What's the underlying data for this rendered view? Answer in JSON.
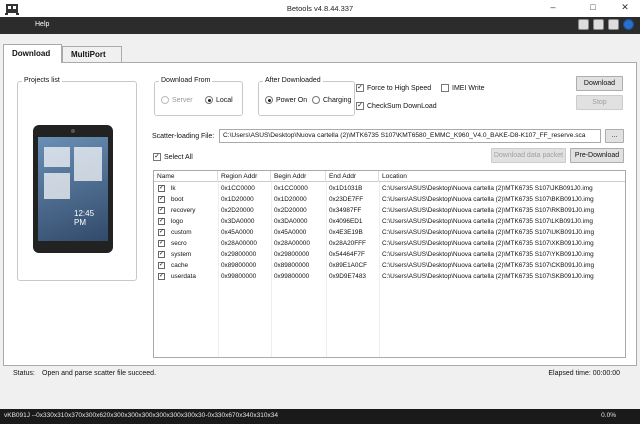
{
  "window": {
    "title": "Betools v4.8.44.337",
    "minimize": "–",
    "maximize": "□",
    "close": "✕"
  },
  "menu": {
    "help": "Help"
  },
  "tabs": [
    {
      "label": "Download"
    },
    {
      "label": "MultiPort"
    }
  ],
  "projects": {
    "label": "Projects list",
    "clock": "12:45 PM"
  },
  "download_from": {
    "label": "Download From",
    "options": [
      "Server",
      "Local"
    ],
    "selected": "Local"
  },
  "after_downloaded": {
    "label": "After Downloaded",
    "options": [
      "Power On",
      "Charging"
    ],
    "selected": "Power On"
  },
  "options": {
    "force_high_speed": {
      "label": "Force to High Speed",
      "checked": true
    },
    "imei_write": {
      "label": "IMEI Write",
      "checked": false
    },
    "checksum_download": {
      "label": "CheckSum DownLoad",
      "checked": true
    }
  },
  "buttons": {
    "download": "Download",
    "stop": "Stop",
    "browse": "...",
    "download_data_packet": "Download data packet",
    "pre_download": "Pre-Download"
  },
  "scatter": {
    "label": "Scatter-loading File:",
    "path": "C:\\Users\\ASUS\\Desktop\\Nuova cartella (2)\\MTK6735 S107\\KMT6580_EMMC_K960_V4.0_BAKE-D8-K107_FF_reserve.sca"
  },
  "select_all": {
    "label": "Select All",
    "checked": true
  },
  "table": {
    "columns": [
      "Name",
      "Region Addr",
      "Begin Addr",
      "End Addr",
      "Location"
    ],
    "rows": [
      [
        "lk",
        "0x1CC0000",
        "0x1CC0000",
        "0x1D1031B",
        "C:\\Users\\ASUS\\Desktop\\Nuova cartella (2)\\MTK6735 S107\\JKB091J0.img"
      ],
      [
        "boot",
        "0x1D20000",
        "0x1D20000",
        "0x23DE7FF",
        "C:\\Users\\ASUS\\Desktop\\Nuova cartella (2)\\MTK6735 S107\\BKB091J0.img"
      ],
      [
        "recovery",
        "0x2D20000",
        "0x2D20000",
        "0x34987FF",
        "C:\\Users\\ASUS\\Desktop\\Nuova cartella (2)\\MTK6735 S107\\RKB091J0.img"
      ],
      [
        "logo",
        "0x3DA0000",
        "0x3DA0000",
        "0x4096ED1",
        "C:\\Users\\ASUS\\Desktop\\Nuova cartella (2)\\MTK6735 S107\\LKB091J0.img"
      ],
      [
        "custom",
        "0x45A0000",
        "0x45A0000",
        "0x4E3E19B",
        "C:\\Users\\ASUS\\Desktop\\Nuova cartella (2)\\MTK6735 S107\\UKB091J0.img"
      ],
      [
        "secro",
        "0x28A00000",
        "0x28A00000",
        "0x28A20FFF",
        "C:\\Users\\ASUS\\Desktop\\Nuova cartella (2)\\MTK6735 S107\\XKB091J0.img"
      ],
      [
        "system",
        "0x29800000",
        "0x29800000",
        "0x54464F7F",
        "C:\\Users\\ASUS\\Desktop\\Nuova cartella (2)\\MTK6735 S107\\YKB091J0.img"
      ],
      [
        "cache",
        "0x89800000",
        "0x89800000",
        "0x89E1A0CF",
        "C:\\Users\\ASUS\\Desktop\\Nuova cartella (2)\\MTK6735 S107\\CKB091J0.img"
      ],
      [
        "userdata",
        "0x99800000",
        "0x99800000",
        "0x9D9E7483",
        "C:\\Users\\ASUS\\Desktop\\Nuova cartella (2)\\MTK6735 S107\\SKB091J0.img"
      ]
    ]
  },
  "status": {
    "label": "Status:",
    "text": "Open and parse scatter file succeed.",
    "elapsed": "Elapsed time:  00:00:00"
  },
  "progress": {
    "info": "vKB091J --0x330x310x370x300x620x300x300x300x300x300x300x30-0x330x670x340x310x34",
    "percent": "0.0%",
    "fraction": 0.0
  }
}
